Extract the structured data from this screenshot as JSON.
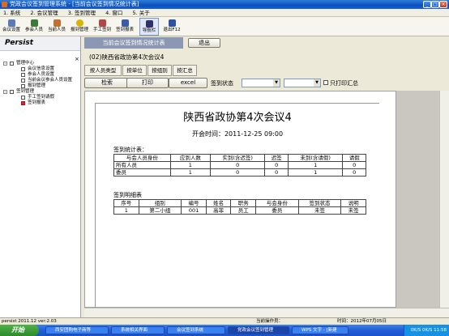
{
  "window": {
    "title": "党政会议签到管理系统 - [当前会议签到情况统计表]"
  },
  "menu": [
    "1. 系统",
    "2. 会议管理",
    "3. 签到管理",
    "4. 窗口",
    "5. 关于"
  ],
  "toolbar": [
    {
      "label": "会议设置",
      "icon": "settings-icon",
      "color": "#5a7ab8"
    },
    {
      "label": "参会人员",
      "icon": "people-icon",
      "color": "#3b7a3b"
    },
    {
      "label": "当前人员",
      "icon": "person-icon",
      "color": "#c07030"
    },
    {
      "label": "报到管理",
      "icon": "report-icon",
      "color": "#d9b400"
    },
    {
      "label": "手工签到",
      "icon": "hand-icon",
      "color": "#b04848"
    },
    {
      "label": "签到报表",
      "icon": "table-icon",
      "color": "#3a5ca8"
    },
    {
      "label": "导航栏",
      "icon": "navbar-icon",
      "color": "#303070"
    },
    {
      "label": "退出F12",
      "icon": "exit-icon",
      "color": "#3050a0"
    }
  ],
  "left_panel": {
    "title": "Persist",
    "close": "×",
    "tree": [
      {
        "label": "管理中心",
        "level": 0,
        "expander": "-"
      },
      {
        "label": "会议信息设置",
        "level": 1
      },
      {
        "label": "参会人员设置",
        "level": 1
      },
      {
        "label": "当前会议参会人员设置",
        "level": 1
      },
      {
        "label": "报到管理",
        "level": 1
      },
      {
        "label": "签到管理",
        "level": 0,
        "expander": "-"
      },
      {
        "label": "手工签到请假",
        "level": 1
      },
      {
        "label": "签到报表",
        "level": 1,
        "icon": "red"
      }
    ]
  },
  "tabs": {
    "active": "当前会议签到情况统计表",
    "exit_button": "退出"
  },
  "meeting_subtitle": "(02)陕西省政协第4次会议4",
  "subtabs": [
    "按人员类型",
    "按单位",
    "按组别",
    "按汇总"
  ],
  "filters": {
    "search_button": "检索",
    "print_button": "打印",
    "excel_button": "excel",
    "status_label": "签到状态",
    "select1_value": "",
    "select2_value": "",
    "print_summary_label": "只打印汇总"
  },
  "report": {
    "title": "陕西省政协第4次会议4",
    "time": "开会时间：2011-12-25 09:00",
    "stats_heading": "签到统计表：",
    "stats_headers": [
      "与会人员身份",
      "应到人数",
      "实到(含迟签)",
      "迟签",
      "未到(含请假)",
      "请假"
    ],
    "stats_rows": [
      [
        "所有人员",
        "1",
        "0",
        "0",
        "1",
        "0"
      ],
      [
        "委员",
        "1",
        "0",
        "0",
        "1",
        "0"
      ]
    ],
    "detail_heading": "签到明细表",
    "detail_headers": [
      "序号",
      "组别",
      "编号",
      "姓名",
      "职务",
      "与会身份",
      "签到状态",
      "说明"
    ],
    "detail_rows": [
      [
        "1",
        "第二小组",
        "001",
        "高菲",
        "员工",
        "委员",
        "未签",
        "未签"
      ]
    ]
  },
  "statusbar": {
    "left": "persist 2011.12 ver:2.03",
    "operator": "当前操作员：",
    "time": "时间：2012年07月05日"
  },
  "taskbar": {
    "start": "开始",
    "items": [
      "西安团购电子商等",
      "系统相关界面",
      "会议签到系统",
      "党政会议签到管理",
      "WPS 文字 - [新建"
    ],
    "active_index": 3,
    "tray_text": "0K/S  0K/S  11:58"
  }
}
